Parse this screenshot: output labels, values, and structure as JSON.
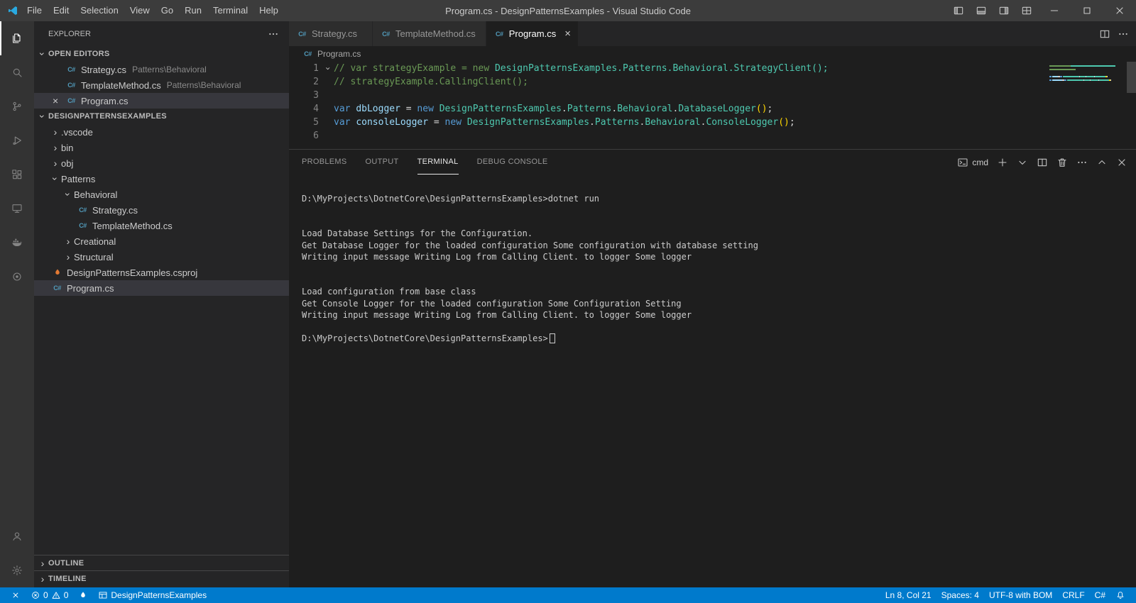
{
  "colors": {
    "status_bar_bg": "#007acc",
    "accent_comment": "#6A9955",
    "accent_keyword": "#569CD6",
    "accent_variable": "#9CDCFE",
    "accent_type": "#4EC9B0",
    "accent_plain": "#D4D4D4",
    "accent_paren": "#FFD700",
    "cs_icon": "#519aba",
    "csproj_icon": "#e37933"
  },
  "icons": {
    "cs_glyph": "C#"
  },
  "title_bar": {
    "menus": [
      "File",
      "Edit",
      "Selection",
      "View",
      "Go",
      "Run",
      "Terminal",
      "Help"
    ],
    "title": "Program.cs - DesignPatternsExamples - Visual Studio Code",
    "window_controls": [
      "minimize",
      "maximize",
      "close"
    ]
  },
  "activity_bar": {
    "top": [
      {
        "id": "explorer",
        "icon": "files-icon",
        "active": true
      },
      {
        "id": "search",
        "icon": "search-icon",
        "active": false
      },
      {
        "id": "source-control",
        "icon": "source-control-icon",
        "active": false
      },
      {
        "id": "run-debug",
        "icon": "run-debug-icon",
        "active": false
      },
      {
        "id": "extensions",
        "icon": "extensions-icon",
        "active": false
      },
      {
        "id": "remote-explorer",
        "icon": "remote-explorer-icon",
        "active": false
      },
      {
        "id": "docker",
        "icon": "docker-icon",
        "active": false
      },
      {
        "id": "extension-circle",
        "icon": "circle-icon",
        "active": false
      }
    ],
    "bottom": [
      {
        "id": "account",
        "icon": "account-icon"
      },
      {
        "id": "settings",
        "icon": "gear-icon"
      }
    ]
  },
  "sidebar": {
    "header": "EXPLORER",
    "open_editors": {
      "label": "OPEN EDITORS",
      "items": [
        {
          "file": "Strategy.cs",
          "detail": "Patterns\\Behavioral",
          "icon": "cs",
          "active": false
        },
        {
          "file": "TemplateMethod.cs",
          "detail": "Patterns\\Behavioral",
          "icon": "cs",
          "active": false
        },
        {
          "file": "Program.cs",
          "detail": "",
          "icon": "cs",
          "active": true
        }
      ]
    },
    "project_label": "DESIGNPATTERNSEXAMPLES",
    "tree": [
      {
        "label": ".vscode",
        "kind": "folder",
        "state": "collapsed",
        "indent": 0
      },
      {
        "label": "bin",
        "kind": "folder",
        "state": "collapsed",
        "indent": 0
      },
      {
        "label": "obj",
        "kind": "folder",
        "state": "collapsed",
        "indent": 0
      },
      {
        "label": "Patterns",
        "kind": "folder",
        "state": "expanded",
        "indent": 0
      },
      {
        "label": "Behavioral",
        "kind": "folder",
        "state": "expanded",
        "indent": 1
      },
      {
        "label": "Strategy.cs",
        "kind": "file",
        "icon": "cs",
        "indent": 2
      },
      {
        "label": "TemplateMethod.cs",
        "kind": "file",
        "icon": "cs",
        "indent": 2
      },
      {
        "label": "Creational",
        "kind": "folder",
        "state": "collapsed",
        "indent": 1
      },
      {
        "label": "Structural",
        "kind": "folder",
        "state": "collapsed",
        "indent": 1
      },
      {
        "label": "DesignPatternsExamples.csproj",
        "kind": "file",
        "icon": "csproj",
        "indent": 0
      },
      {
        "label": "Program.cs",
        "kind": "file",
        "icon": "cs",
        "indent": 0,
        "selected": true
      }
    ],
    "bottom_sections": [
      "OUTLINE",
      "TIMELINE"
    ]
  },
  "editor": {
    "tabs": [
      {
        "label": "Strategy.cs",
        "icon": "cs",
        "active": false
      },
      {
        "label": "TemplateMethod.cs",
        "icon": "cs",
        "active": false
      },
      {
        "label": "Program.cs",
        "icon": "cs",
        "active": true
      }
    ],
    "breadcrumb": "Program.cs",
    "code_lines": [
      {
        "n": "1",
        "fold": true,
        "tokens": [
          {
            "t": "// var strategyExample = new ",
            "c": "comment"
          },
          {
            "t": "DesignPatternsExamples.Patterns.Behavioral.StrategyClient();",
            "c": "type"
          }
        ]
      },
      {
        "n": "2",
        "fold": false,
        "tokens": [
          {
            "t": "// strategyExample.CallingClient();",
            "c": "comment"
          }
        ]
      },
      {
        "n": "3",
        "fold": false,
        "tokens": []
      },
      {
        "n": "4",
        "fold": false,
        "tokens": [
          {
            "t": "var",
            "c": "keyword"
          },
          {
            "t": " ",
            "c": "plain"
          },
          {
            "t": "dbLogger",
            "c": "variable"
          },
          {
            "t": " = ",
            "c": "plain"
          },
          {
            "t": "new",
            "c": "keyword"
          },
          {
            "t": " ",
            "c": "plain"
          },
          {
            "t": "DesignPatternsExamples",
            "c": "type"
          },
          {
            "t": ".",
            "c": "plain"
          },
          {
            "t": "Patterns",
            "c": "type"
          },
          {
            "t": ".",
            "c": "plain"
          },
          {
            "t": "Behavioral",
            "c": "type"
          },
          {
            "t": ".",
            "c": "plain"
          },
          {
            "t": "DatabaseLogger",
            "c": "type"
          },
          {
            "t": "(",
            "c": "paren"
          },
          {
            "t": ")",
            "c": "paren"
          },
          {
            "t": ";",
            "c": "plain"
          }
        ]
      },
      {
        "n": "5",
        "fold": false,
        "tokens": [
          {
            "t": "var",
            "c": "keyword"
          },
          {
            "t": " ",
            "c": "plain"
          },
          {
            "t": "consoleLogger",
            "c": "variable"
          },
          {
            "t": " = ",
            "c": "plain"
          },
          {
            "t": "new",
            "c": "keyword"
          },
          {
            "t": " ",
            "c": "plain"
          },
          {
            "t": "DesignPatternsExamples",
            "c": "type"
          },
          {
            "t": ".",
            "c": "plain"
          },
          {
            "t": "Patterns",
            "c": "type"
          },
          {
            "t": ".",
            "c": "plain"
          },
          {
            "t": "Behavioral",
            "c": "type"
          },
          {
            "t": ".",
            "c": "plain"
          },
          {
            "t": "ConsoleLogger",
            "c": "type"
          },
          {
            "t": "(",
            "c": "paren"
          },
          {
            "t": ")",
            "c": "paren"
          },
          {
            "t": ";",
            "c": "plain"
          }
        ]
      },
      {
        "n": "6",
        "fold": false,
        "tokens": []
      }
    ]
  },
  "panel": {
    "tabs": [
      {
        "label": "PROBLEMS",
        "active": false
      },
      {
        "label": "OUTPUT",
        "active": false
      },
      {
        "label": "TERMINAL",
        "active": true
      },
      {
        "label": "DEBUG CONSOLE",
        "active": false
      }
    ],
    "profile_label": "cmd",
    "terminal_lines": [
      "D:\\MyProjects\\DotnetCore\\DesignPatternsExamples>dotnet run",
      "",
      "",
      "Load Database Settings for the Configuration.",
      "Get Database Logger for the loaded configuration Some configuration with database setting",
      "Writing input message Writing Log from Calling Client. to logger Some logger",
      "",
      "",
      "Load configuration from base class",
      "Get Console Logger for the loaded configuration Some Configuration Setting",
      "Writing input message Writing Log from Calling Client. to logger Some logger",
      "",
      "D:\\MyProjects\\DotnetCore\\DesignPatternsExamples>"
    ],
    "cursor_after_last_line": true
  },
  "status_bar": {
    "left": {
      "errors": "0",
      "warnings": "0",
      "project": "DesignPatternsExamples"
    },
    "right": [
      "Ln 8, Col 21",
      "Spaces: 4",
      "UTF-8 with BOM",
      "CRLF",
      "C#"
    ]
  }
}
